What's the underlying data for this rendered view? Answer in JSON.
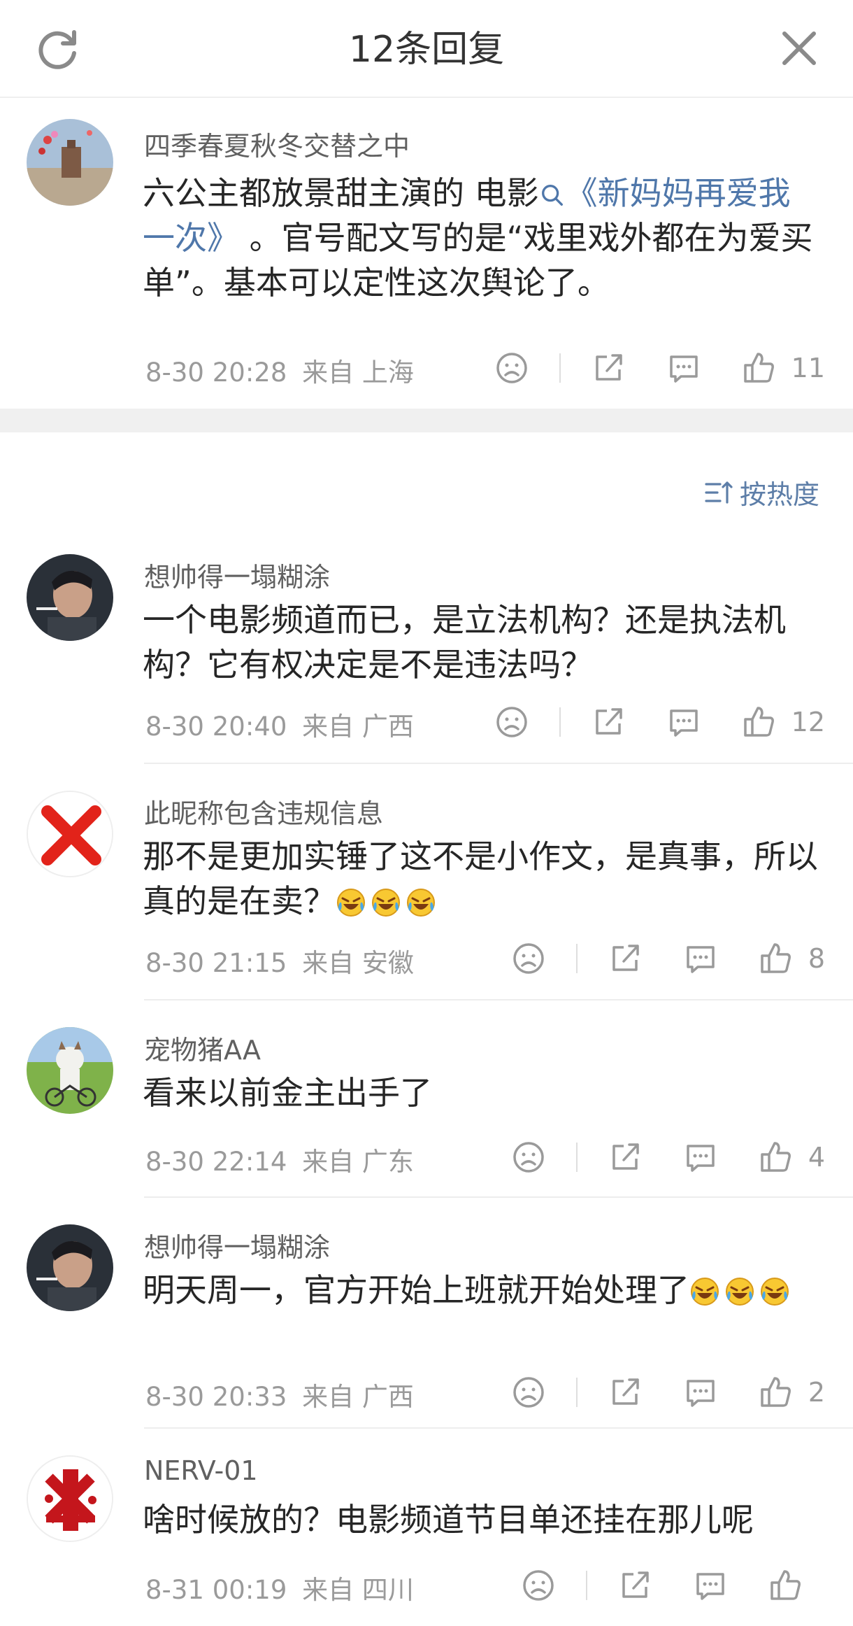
{
  "header": {
    "title": "12条回复"
  },
  "main_post": {
    "username": "四季春夏秋冬交替之中",
    "text_before": "六公主都放景甜主演的 电影",
    "link_text": "《新妈妈再爱我一次》",
    "text_after": " 。官号配文写的是“戏里戏外都在为爱买单”。基本可以定性这次舆论了。",
    "time": "8-30 20:28",
    "location": "来自 上海",
    "likes": "11"
  },
  "sort": {
    "label": "按热度"
  },
  "replies": [
    {
      "username": "想帅得一塌糊涂",
      "text": "一个电影频道而已，是立法机构？还是执法机构？它有权决定是不是违法吗？",
      "time": "8-30 20:40",
      "location": "来自 广西",
      "likes": "12"
    },
    {
      "username": "此昵称包含违规信息",
      "text": "那不是更加实锤了这不是小作文，是真事，所以真的是在卖？",
      "time": "8-30 21:15",
      "location": "来自 安徽",
      "likes": "8"
    },
    {
      "username": "宠物猪AA",
      "text": "看来以前金主出手了",
      "time": "8-30 22:14",
      "location": "来自 广东",
      "likes": "4"
    },
    {
      "username": "想帅得一塌糊涂",
      "text": "明天周一，官方开始上班就开始处理了",
      "time": "8-30 20:33",
      "location": "来自 广西",
      "likes": "2"
    },
    {
      "username": "NERV-01",
      "text": "啥时候放的？电影频道节目单还挂在那儿呢",
      "time": "8-31 00:19",
      "location": "来自 四川",
      "likes": ""
    }
  ],
  "icons": {
    "refresh": "refresh-icon",
    "close": "close-icon",
    "dislike": "frown-icon",
    "share": "share-icon",
    "comment": "comment-icon",
    "like": "thumbs-up-icon",
    "search": "search-icon",
    "sort": "sort-icon",
    "emoji": "laugh-cry-emoji"
  },
  "colors": {
    "link": "#4f77aa",
    "sort": "#5d7ea8",
    "meta": "#9a9a9a",
    "separator": "#f0f0f0"
  }
}
